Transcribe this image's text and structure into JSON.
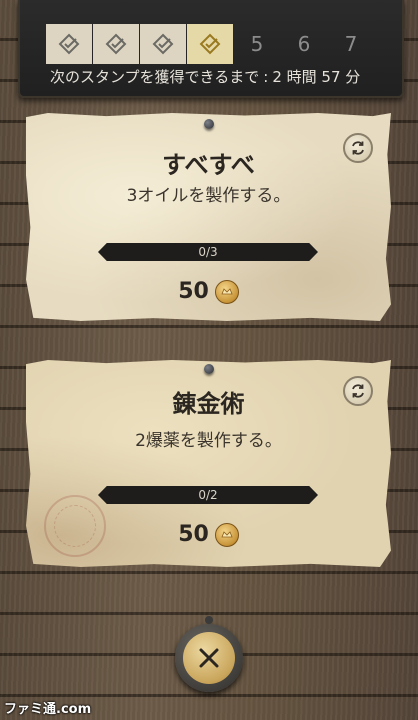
{
  "stamps": {
    "items": [
      {
        "state": "done",
        "icon": "check-diamond-icon"
      },
      {
        "state": "done",
        "icon": "check-diamond-icon"
      },
      {
        "state": "done",
        "icon": "check-diamond-icon"
      },
      {
        "state": "active",
        "icon": "check-diamond-icon"
      },
      {
        "state": "locked",
        "label": "5"
      },
      {
        "state": "locked",
        "label": "6"
      },
      {
        "state": "locked",
        "label": "7"
      }
    ],
    "countdown_label": "次のスタンプを獲得できるまで",
    "countdown_sep": ":",
    "countdown_value": "2 時間 57 分"
  },
  "tasks": [
    {
      "title": "すべすべ",
      "description": "3オイルを製作する。",
      "progress": "0/3",
      "progress_fraction": 0,
      "reward": "50"
    },
    {
      "title": "錬金術",
      "description": "2爆薬を製作する。",
      "progress": "0/2",
      "progress_fraction": 0,
      "reward": "50"
    }
  ],
  "watermark": "ファミ通.com",
  "colors": {
    "parchment": "#e7dcc1",
    "stamp_active": "#e6d9a8",
    "coin": "#c89438",
    "close_button": "#c9a55b"
  }
}
